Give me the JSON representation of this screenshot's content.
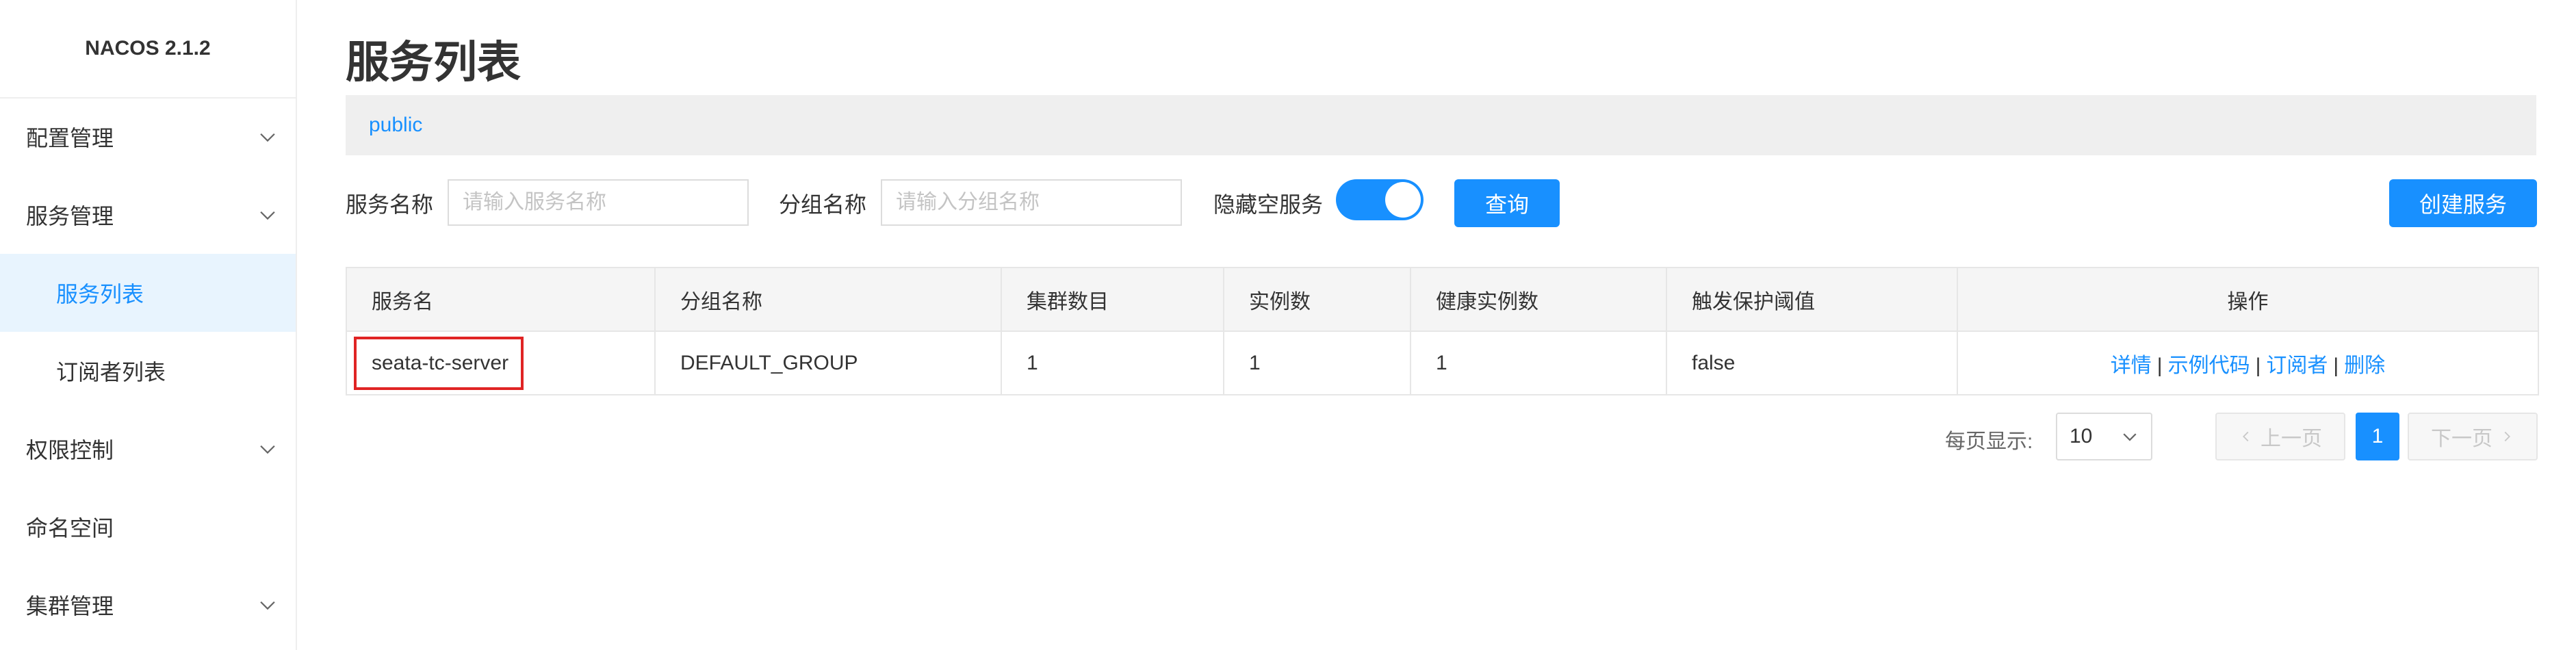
{
  "app": {
    "brand": "NACOS 2.1.2"
  },
  "sidebar": {
    "items": [
      {
        "label": "配置管理",
        "expandable": true
      },
      {
        "label": "服务管理",
        "expandable": true
      },
      {
        "label": "服务列表",
        "sub": true,
        "active": true
      },
      {
        "label": "订阅者列表",
        "sub": true
      },
      {
        "label": "权限控制",
        "expandable": true
      },
      {
        "label": "命名空间",
        "expandable": false
      },
      {
        "label": "集群管理",
        "expandable": true
      }
    ]
  },
  "page": {
    "title": "服务列表",
    "namespace": "public"
  },
  "filters": {
    "service_name_label": "服务名称",
    "service_name_placeholder": "请输入服务名称",
    "service_name_value": "",
    "group_name_label": "分组名称",
    "group_name_placeholder": "请输入分组名称",
    "group_name_value": "",
    "hide_empty_label": "隐藏空服务",
    "hide_empty_on": true,
    "query_button": "查询",
    "create_button": "创建服务"
  },
  "table": {
    "columns": [
      "服务名",
      "分组名称",
      "集群数目",
      "实例数",
      "健康实例数",
      "触发保护阈值",
      "操作"
    ],
    "rows": [
      {
        "service_name": "seata-tc-server",
        "group": "DEFAULT_GROUP",
        "clusters": "1",
        "instances": "1",
        "healthy_instances": "1",
        "protect_threshold": "false",
        "ops": [
          "详情",
          "示例代码",
          "订阅者",
          "删除"
        ],
        "ops_separator": "|"
      }
    ]
  },
  "pagination": {
    "per_page_label": "每页显示:",
    "per_page_value": "10",
    "prev": "上一页",
    "next": "下一页",
    "current_page": "1"
  },
  "colors": {
    "accent": "#1890ff",
    "highlight": "#e02424",
    "sidebar_active_bg": "#e8f4fe"
  }
}
